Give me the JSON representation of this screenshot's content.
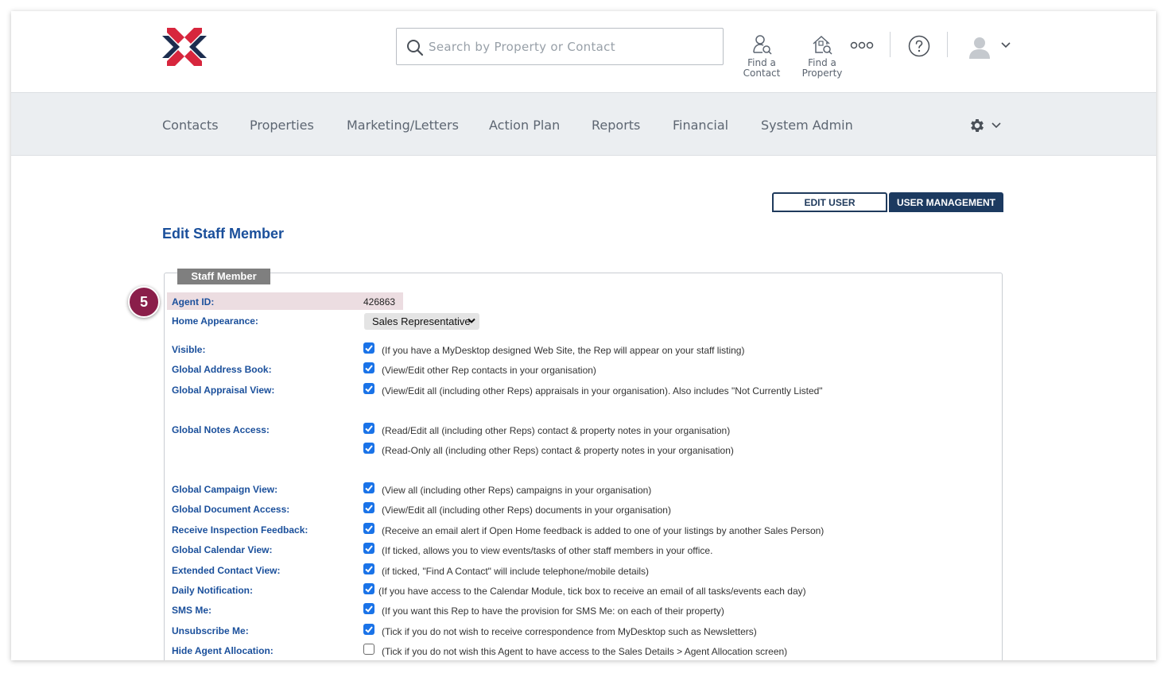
{
  "header": {
    "search_placeholder": "Search by Property or Contact",
    "find_contact_label_1": "Find a",
    "find_contact_label_2": "Contact",
    "find_property_label_1": "Find a",
    "find_property_label_2": "Property",
    "brand_colors": {
      "navy": "#1c2d4f",
      "red": "#d7263d"
    }
  },
  "nav": {
    "items": [
      "Contacts",
      "Properties",
      "Marketing/Letters",
      "Action Plan",
      "Reports",
      "Financial",
      "System Admin"
    ]
  },
  "tabs": {
    "edit_user": "EDIT USER",
    "user_management": "USER MANAGEMENT"
  },
  "page_title": "Edit Staff Member",
  "panel": {
    "legend": "Staff Member",
    "step_number": "5",
    "agent_id_label": "Agent ID:",
    "agent_id_value": "426863",
    "home_appearance_label": "Home Appearance:",
    "home_appearance_value": "Sales Representative",
    "rows": [
      {
        "label": "Visible:",
        "checked": true,
        "desc": "(If you have a MyDesktop designed Web Site, the Rep will appear on your staff listing)"
      },
      {
        "label": "Global Address Book:",
        "checked": true,
        "desc": "(View/Edit other Rep contacts in your organisation)"
      },
      {
        "label": "Global Appraisal View:",
        "checked": true,
        "desc": "(View/Edit all (including other Reps) appraisals in your organisation). Also includes \"Not Currently Listed\""
      },
      {
        "label": "Global Notes Access:",
        "checked": true,
        "desc": "(Read/Edit all (including other Reps) contact & property notes in your organisation)"
      },
      {
        "label": "",
        "checked": true,
        "desc": "(Read-Only all (including other Reps) contact & property notes in your organisation)"
      },
      {
        "label": "Global Campaign View:",
        "checked": true,
        "desc": "(View all (including other Reps) campaigns in your organisation)"
      },
      {
        "label": "Global Document Access:",
        "checked": true,
        "desc": "(View/Edit all (including other Reps) documents in your organisation)"
      },
      {
        "label": "Receive Inspection Feedback:",
        "checked": true,
        "desc": "(Receive an email alert if Open Home feedback is added to one of your listings by another Sales Person)"
      },
      {
        "label": "Global Calendar View:",
        "checked": true,
        "desc": "(If ticked, allows you to view events/tasks of other staff members in your office."
      },
      {
        "label": "Extended Contact View:",
        "checked": true,
        "desc": "(if ticked, \"Find A Contact\" will include telephone/mobile details)"
      },
      {
        "label": "Daily Notification:",
        "checked": true,
        "desc": "(If you have access to the Calendar Module, tick box to receive an email of all tasks/events each day)"
      },
      {
        "label": "SMS Me:",
        "checked": true,
        "desc": "(If you want this Rep to have the provision for SMS Me: on each of their property)"
      },
      {
        "label": "Unsubscribe Me:",
        "checked": true,
        "desc": "(Tick if you do not wish to receive correspondence from MyDesktop such as Newsletters)"
      },
      {
        "label": "Hide Agent Allocation:",
        "checked": false,
        "desc": "(Tick if you do not wish this Agent to have access to the Sales Details > Agent Allocation screen)"
      }
    ]
  }
}
